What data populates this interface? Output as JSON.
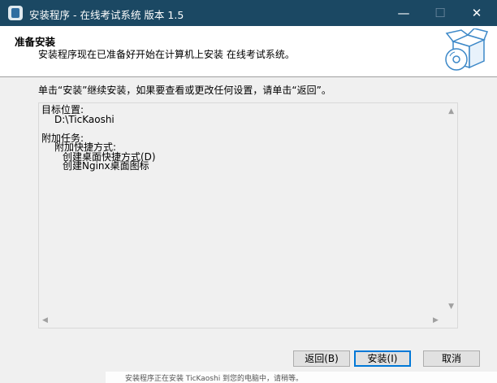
{
  "window": {
    "title": "安装程序 - 在线考试系统 版本 1.5",
    "buttons": {
      "minimize": "—",
      "maximize": "☐",
      "close": "✕"
    }
  },
  "header": {
    "title": "准备安装",
    "subtitle": "安装程序现在已准备好开始在计算机上安装 在线考试系统。"
  },
  "instruction": "单击“安装”继续安装，如果要查看或更改任何设置，请单击“返回”。",
  "memo": {
    "dest_label": "目标位置:",
    "dest_value": "D:\\TicKaoshi",
    "tasks_label": "附加任务:",
    "shortcut_label": "附加快捷方式:",
    "task1": "创建桌面快捷方式(D)",
    "task2": "创建Nginx桌面图标"
  },
  "buttons": {
    "back": "返回(B)",
    "install": "安装(I)",
    "cancel": "取消"
  },
  "background_text": "安装程序正在安装 TicKaoshi 到您的电脑中，请稍等。"
}
